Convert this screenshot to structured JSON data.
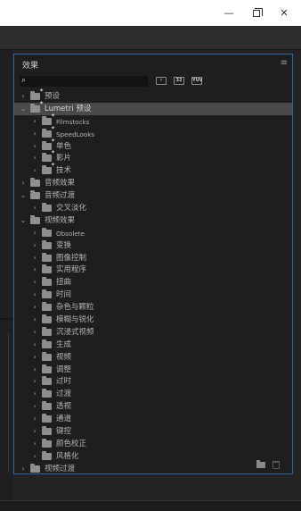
{
  "window": {
    "minimize_glyph": "—",
    "close_glyph": "✕"
  },
  "panel": {
    "title": "效果",
    "menu_glyph": "≡",
    "search": {
      "value": "",
      "placeholder": "",
      "icon": "search-icon"
    },
    "filter_buttons": [
      {
        "name": "accelerated-effects-icon",
        "glyph": "⚡"
      },
      {
        "name": "32bit-color-icon",
        "glyph": "32"
      },
      {
        "name": "yuv-effects-icon",
        "glyph": "YUV"
      }
    ],
    "tree": [
      {
        "label": "预设",
        "level": 0,
        "expanded": false,
        "icon": "preset-folder-icon",
        "selected": false,
        "en": false
      },
      {
        "label": "Lumetri 预设",
        "level": 0,
        "expanded": true,
        "icon": "preset-folder-icon",
        "selected": true,
        "en": false
      },
      {
        "label": "Filmstocks",
        "level": 1,
        "expanded": false,
        "icon": "preset-folder-icon",
        "selected": false,
        "en": true
      },
      {
        "label": "SpeedLooks",
        "level": 1,
        "expanded": false,
        "icon": "preset-folder-icon",
        "selected": false,
        "en": true
      },
      {
        "label": "单色",
        "level": 1,
        "expanded": false,
        "icon": "preset-folder-icon",
        "selected": false,
        "en": false
      },
      {
        "label": "影片",
        "level": 1,
        "expanded": false,
        "icon": "preset-folder-icon",
        "selected": false,
        "en": false
      },
      {
        "label": "技术",
        "level": 1,
        "expanded": false,
        "icon": "preset-folder-icon",
        "selected": false,
        "en": false
      },
      {
        "label": "音频效果",
        "level": 0,
        "expanded": false,
        "icon": "folder-icon",
        "selected": false,
        "en": false
      },
      {
        "label": "音频过渡",
        "level": 0,
        "expanded": true,
        "icon": "folder-icon",
        "selected": false,
        "en": false
      },
      {
        "label": "交叉淡化",
        "level": 1,
        "expanded": false,
        "icon": "folder-icon",
        "selected": false,
        "en": false
      },
      {
        "label": "视频效果",
        "level": 0,
        "expanded": true,
        "icon": "folder-icon",
        "selected": false,
        "en": false
      },
      {
        "label": "Obsolete",
        "level": 1,
        "expanded": false,
        "icon": "folder-icon",
        "selected": false,
        "en": true
      },
      {
        "label": "变换",
        "level": 1,
        "expanded": false,
        "icon": "folder-icon",
        "selected": false,
        "en": false
      },
      {
        "label": "图像控制",
        "level": 1,
        "expanded": false,
        "icon": "folder-icon",
        "selected": false,
        "en": false
      },
      {
        "label": "实用程序",
        "level": 1,
        "expanded": false,
        "icon": "folder-icon",
        "selected": false,
        "en": false
      },
      {
        "label": "扭曲",
        "level": 1,
        "expanded": false,
        "icon": "folder-icon",
        "selected": false,
        "en": false
      },
      {
        "label": "时间",
        "level": 1,
        "expanded": false,
        "icon": "folder-icon",
        "selected": false,
        "en": false
      },
      {
        "label": "杂色与颗粒",
        "level": 1,
        "expanded": false,
        "icon": "folder-icon",
        "selected": false,
        "en": false
      },
      {
        "label": "模糊与锐化",
        "level": 1,
        "expanded": false,
        "icon": "folder-icon",
        "selected": false,
        "en": false
      },
      {
        "label": "沉浸式视频",
        "level": 1,
        "expanded": false,
        "icon": "folder-icon",
        "selected": false,
        "en": false
      },
      {
        "label": "生成",
        "level": 1,
        "expanded": false,
        "icon": "folder-icon",
        "selected": false,
        "en": false
      },
      {
        "label": "视频",
        "level": 1,
        "expanded": false,
        "icon": "folder-icon",
        "selected": false,
        "en": false
      },
      {
        "label": "调整",
        "level": 1,
        "expanded": false,
        "icon": "folder-icon",
        "selected": false,
        "en": false
      },
      {
        "label": "过时",
        "level": 1,
        "expanded": false,
        "icon": "folder-icon",
        "selected": false,
        "en": false
      },
      {
        "label": "过渡",
        "level": 1,
        "expanded": false,
        "icon": "folder-icon",
        "selected": false,
        "en": false
      },
      {
        "label": "透视",
        "level": 1,
        "expanded": false,
        "icon": "folder-icon",
        "selected": false,
        "en": false
      },
      {
        "label": "通道",
        "level": 1,
        "expanded": false,
        "icon": "folder-icon",
        "selected": false,
        "en": false
      },
      {
        "label": "键控",
        "level": 1,
        "expanded": false,
        "icon": "folder-icon",
        "selected": false,
        "en": false
      },
      {
        "label": "颜色校正",
        "level": 1,
        "expanded": false,
        "icon": "folder-icon",
        "selected": false,
        "en": false
      },
      {
        "label": "风格化",
        "level": 1,
        "expanded": false,
        "icon": "folder-icon",
        "selected": false,
        "en": false
      },
      {
        "label": "视频过渡",
        "level": 0,
        "expanded": false,
        "icon": "folder-icon",
        "selected": false,
        "en": false
      }
    ],
    "footer": {
      "new_bin_icon": "new-bin-icon",
      "delete_icon": "trash-icon"
    }
  },
  "colors": {
    "panel_bg": "#1e1e1e",
    "focus_border": "#2d68a5",
    "selection_bg": "#4a4a4a",
    "text": "#b4b4b4"
  }
}
